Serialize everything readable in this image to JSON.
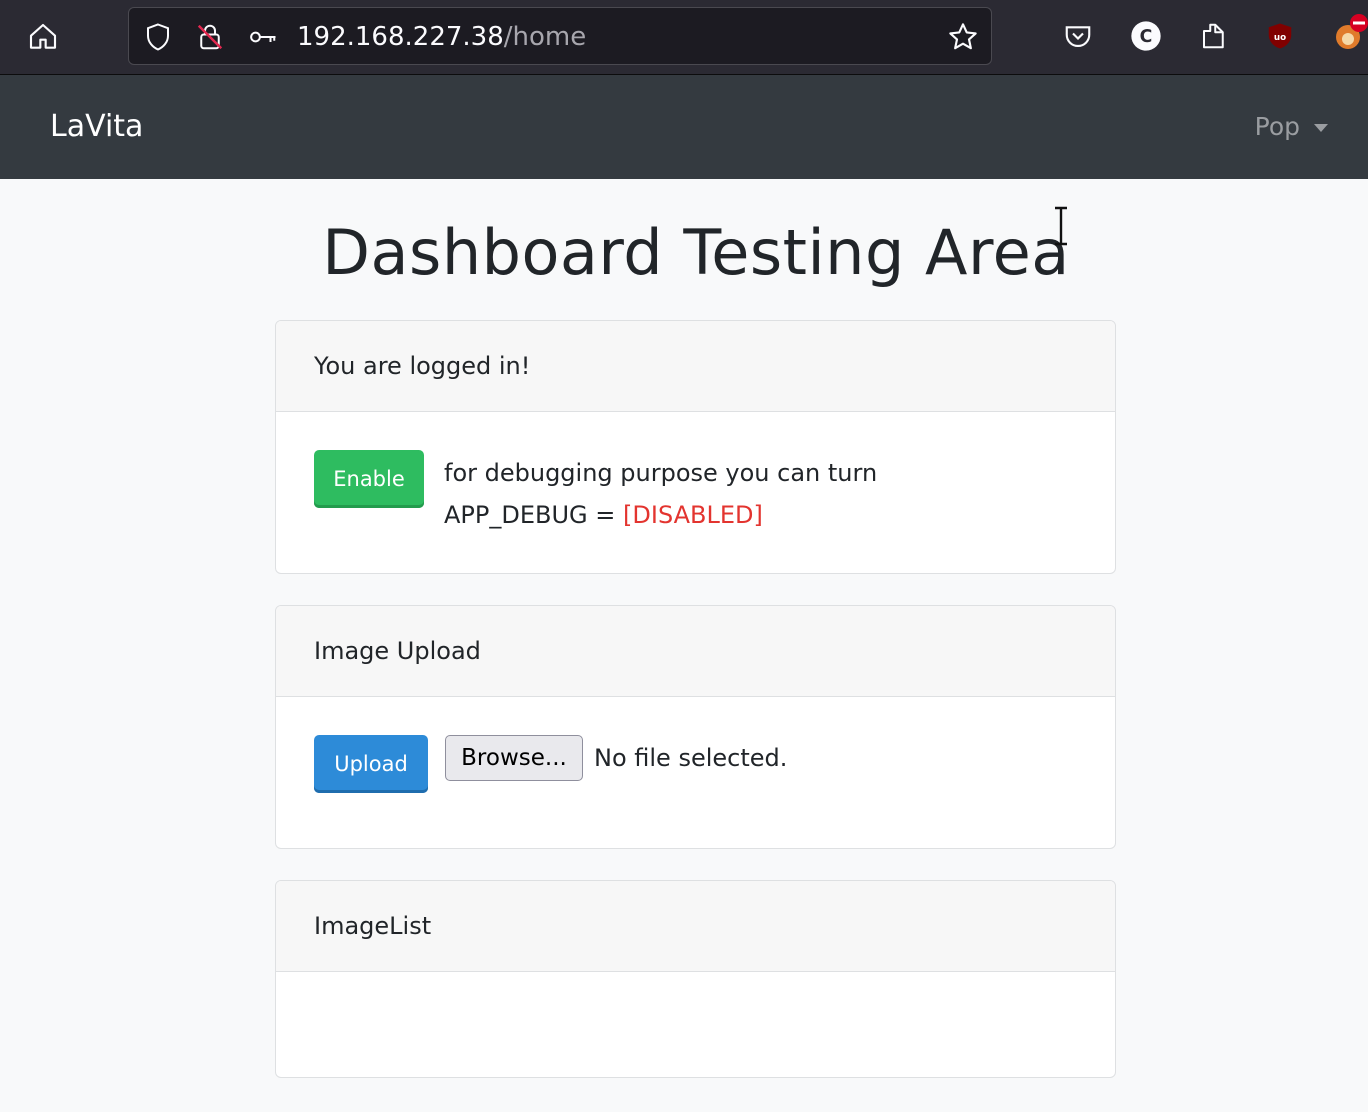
{
  "browser": {
    "url_host": "192.168.227.38",
    "url_path": "/home",
    "icons": [
      "home-icon",
      "shield-icon",
      "insecure-lock-icon",
      "key-icon",
      "bookmark-star-icon",
      "pocket-icon",
      "c-extension-icon",
      "share-icon",
      "ublock-icon",
      "extension-icon"
    ]
  },
  "navbar": {
    "brand": "LaVita",
    "user_name": "Pop",
    "background": "#343a40"
  },
  "main": {
    "title": "Dashboard Testing Area",
    "login_card": {
      "header": "You are logged in!",
      "enable_button": "Enable",
      "debug_line1": "for debugging purpose you can turn",
      "debug_line2_prefix": "APP_DEBUG = ",
      "debug_status": "[DISABLED]"
    },
    "upload_card": {
      "header": "Image Upload",
      "upload_button": "Upload",
      "browse_button": "Browse...",
      "file_status": "No file selected."
    },
    "imagelist_card": {
      "header": "ImageList"
    }
  },
  "colors": {
    "enable_button": "#2ebc60",
    "upload_button": "#2d8bd8",
    "disabled_text": "#e3342f"
  }
}
